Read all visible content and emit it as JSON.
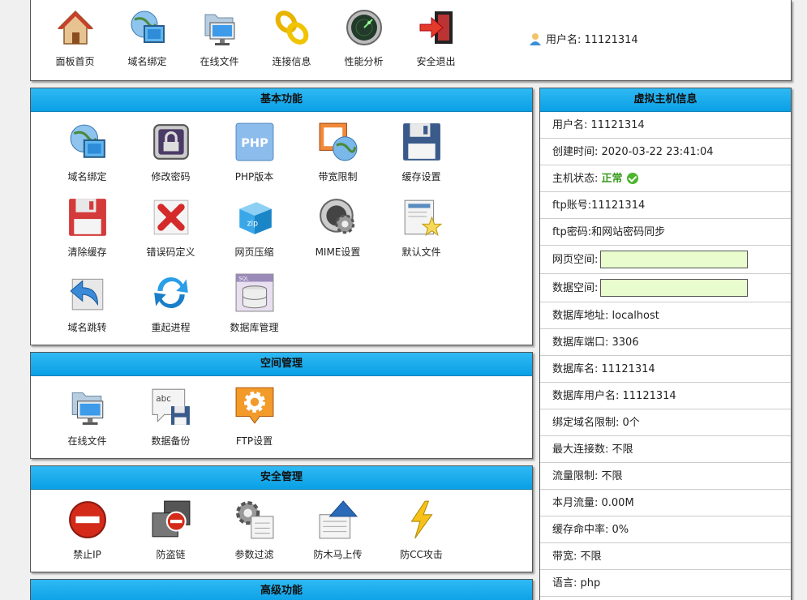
{
  "topnav": [
    {
      "label": "面板首页",
      "icon": "house-icon"
    },
    {
      "label": "域名绑定",
      "icon": "globe-window-icon"
    },
    {
      "label": "在线文件",
      "icon": "folder-monitor-icon"
    },
    {
      "label": "连接信息",
      "icon": "chain-link-icon"
    },
    {
      "label": "性能分析",
      "icon": "radar-icon"
    },
    {
      "label": "安全退出",
      "icon": "exit-door-icon"
    }
  ],
  "user": {
    "label": "用户名: 11121314"
  },
  "sections": {
    "basic": {
      "title": "基本功能",
      "items": [
        {
          "label": "域名绑定",
          "icon": "globe-window-icon"
        },
        {
          "label": "修改密码",
          "icon": "lock-icon"
        },
        {
          "label": "PHP版本",
          "icon": "php-icon"
        },
        {
          "label": "带宽限制",
          "icon": "bandwidth-globe-icon"
        },
        {
          "label": "缓存设置",
          "icon": "floppy-disk-icon"
        },
        {
          "label": "清除缓存",
          "icon": "floppy-disk-red-icon"
        },
        {
          "label": "错误码定义",
          "icon": "red-x-icon"
        },
        {
          "label": "网页压缩",
          "icon": "zip-box-icon"
        },
        {
          "label": "MIME设置",
          "icon": "gear-disc-icon"
        },
        {
          "label": "默认文件",
          "icon": "document-star-icon"
        },
        {
          "label": "域名跳转",
          "icon": "redirect-arrow-icon"
        },
        {
          "label": "重起进程",
          "icon": "restart-arrows-icon"
        },
        {
          "label": "数据库管理",
          "icon": "sql-database-icon"
        }
      ]
    },
    "space": {
      "title": "空间管理",
      "items": [
        {
          "label": "在线文件",
          "icon": "folder-monitor-icon"
        },
        {
          "label": "数据备份",
          "icon": "abc-floppy-icon"
        },
        {
          "label": "FTP设置",
          "icon": "ftp-gear-icon"
        }
      ]
    },
    "security": {
      "title": "安全管理",
      "items": [
        {
          "label": "禁止IP",
          "icon": "no-entry-icon"
        },
        {
          "label": "防盗链",
          "icon": "hotlink-block-icon"
        },
        {
          "label": "参数过滤",
          "icon": "filter-gear-icon"
        },
        {
          "label": "防木马上传",
          "icon": "upload-arrow-icon"
        },
        {
          "label": "防CC攻击",
          "icon": "lightning-icon"
        }
      ]
    },
    "advanced": {
      "title": "高级功能"
    }
  },
  "info": {
    "title": "虚拟主机信息",
    "username": "用户名: 11121314",
    "created": "创建时间: 2020-03-22 23:41:04",
    "status_label": "主机状态:",
    "status_value": "正常",
    "ftp_account": "ftp账号:11121314",
    "ftp_password": "ftp密码:和网站密码同步",
    "web_space_label": "网页空间:",
    "db_space_label": "数据空间:",
    "db_host": "数据库地址: localhost",
    "db_port": "数据库端口: 3306",
    "db_name": "数据库名: 11121314",
    "db_user": "数据库用户名: 11121314",
    "domain_limit": "绑定域名限制: 0个",
    "max_conn": "最大连接数: 不限",
    "traffic_limit": "流量限制: 不限",
    "month_traffic": "本月流量: 0.00M",
    "cache_hit": "缓存命中率: 0%",
    "bandwidth": "带宽: 不限",
    "language": "语言: php"
  },
  "colors": {
    "header_blue": "#1aaeee",
    "status_green": "#3a9a1e",
    "bar_fill": "#e8fccd"
  }
}
